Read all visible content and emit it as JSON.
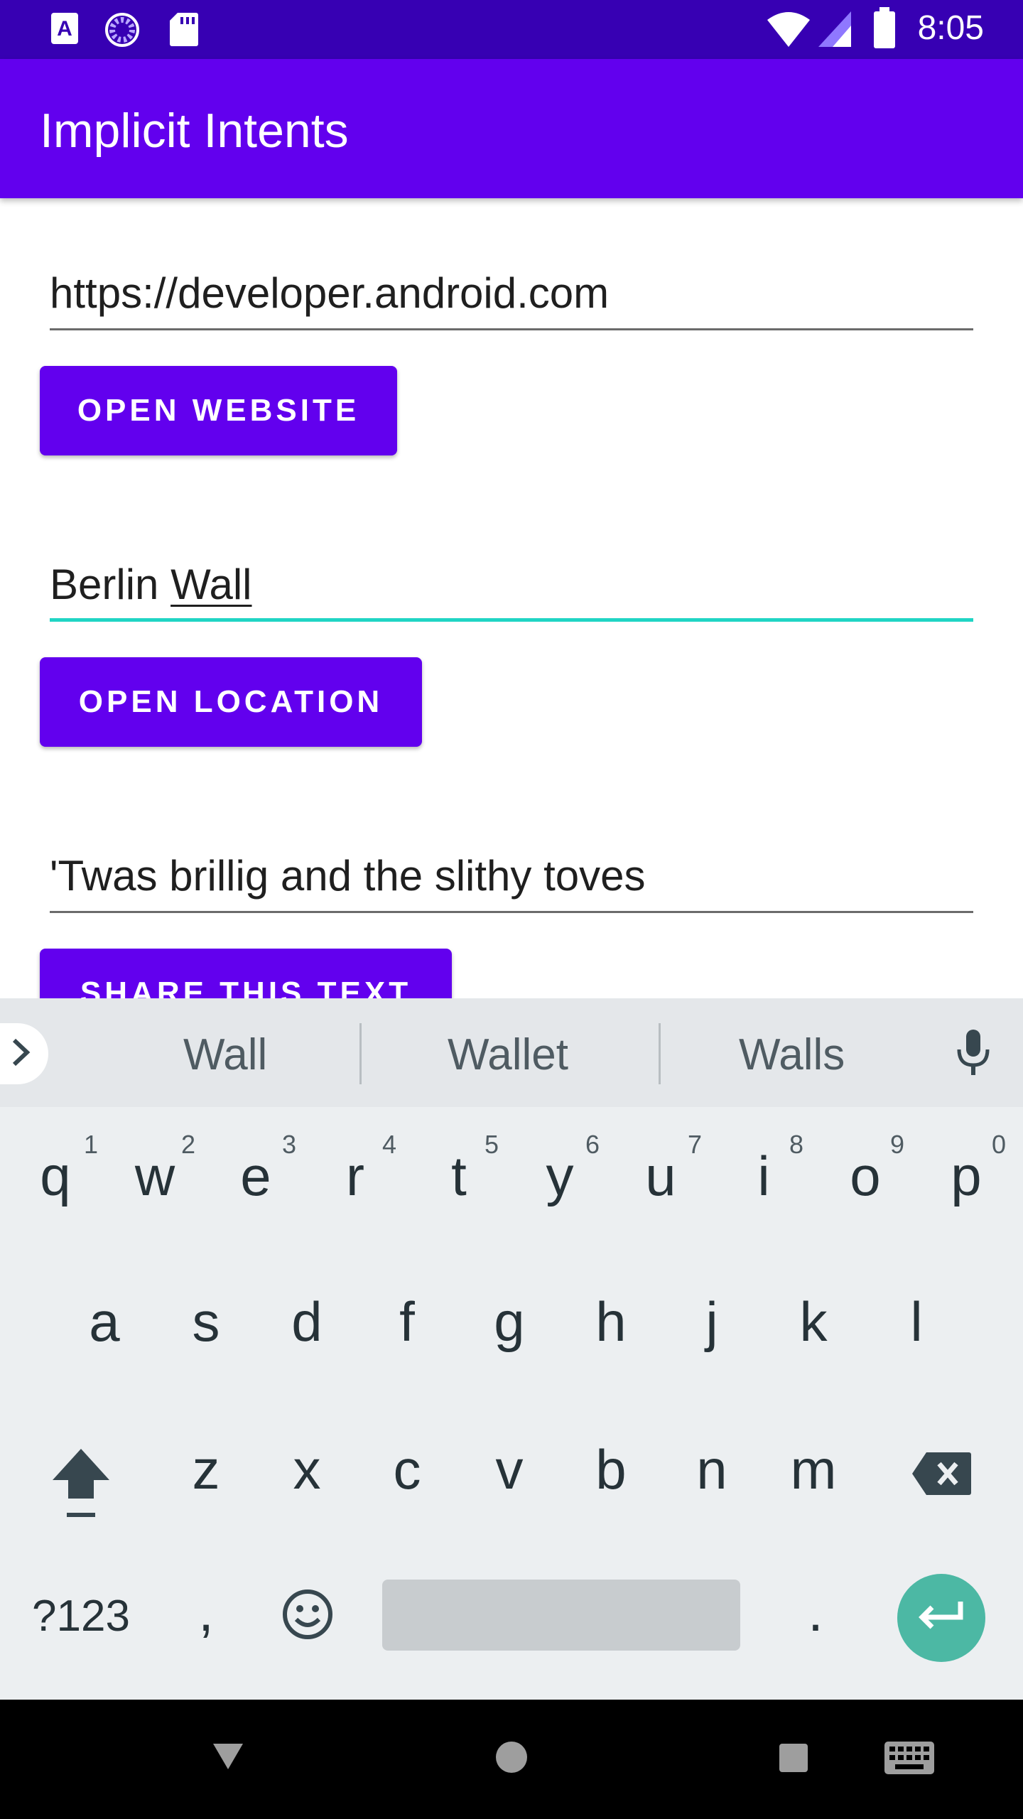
{
  "status_bar": {
    "time": "8:05",
    "icons": [
      "a-badge-icon",
      "loading-circle-icon",
      "sd-card-icon",
      "wifi-icon",
      "signal-icon",
      "battery-icon"
    ]
  },
  "app_bar": {
    "title": "Implicit Intents"
  },
  "website": {
    "value": "https://developer.android.com",
    "button_label": "OPEN WEBSITE"
  },
  "location": {
    "value_prefix": "Berlin ",
    "value_composing": "Wall",
    "button_label": "OPEN LOCATION"
  },
  "share": {
    "value": "'Twas brillig and the slithy toves",
    "button_label": "SHARE THIS TEXT"
  },
  "keyboard": {
    "suggestions": [
      "Wall",
      "Wallet",
      "Walls"
    ],
    "row1": [
      "q",
      "w",
      "e",
      "r",
      "t",
      "y",
      "u",
      "i",
      "o",
      "p"
    ],
    "row1_hints": [
      "1",
      "2",
      "3",
      "4",
      "5",
      "6",
      "7",
      "8",
      "9",
      "0"
    ],
    "row2": [
      "a",
      "s",
      "d",
      "f",
      "g",
      "h",
      "j",
      "k",
      "l"
    ],
    "row3": [
      "z",
      "x",
      "c",
      "v",
      "b",
      "n",
      "m"
    ],
    "symbols_label": "?123",
    "comma": ",",
    "period": "."
  },
  "nav_bar": {
    "icons": [
      "back-icon",
      "home-icon",
      "recents-icon",
      "keyboard-switch-icon"
    ]
  },
  "colors": {
    "primary": "#6200ee",
    "primary_dark": "#3700b3",
    "accent": "#20d5c4",
    "enter_key": "#4cb8a4"
  }
}
